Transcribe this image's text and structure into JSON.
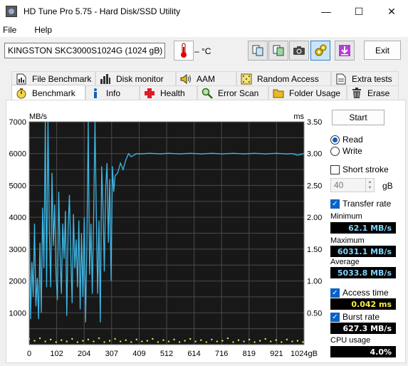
{
  "window": {
    "title": "HD Tune Pro 5.75 - Hard Disk/SSD Utility",
    "minimize": "—",
    "maximize": "☐",
    "close": "✕"
  },
  "menu": {
    "file": "File",
    "help": "Help"
  },
  "toolbar": {
    "drive": "KINGSTON SKC3000S1024G (1024 gB)",
    "temperature": "– °C",
    "exit": "Exit"
  },
  "tabs_row1": [
    "File Benchmark",
    "Disk monitor",
    "AAM",
    "Random Access",
    "Extra tests"
  ],
  "tabs_row2": [
    "Benchmark",
    "Info",
    "Health",
    "Error Scan",
    "Folder Usage",
    "Erase"
  ],
  "active_tab": "Benchmark",
  "controls": {
    "start": "Start",
    "read": "Read",
    "write": "Write",
    "mode": "Read",
    "short_stroke": "Short stroke",
    "short_stroke_checked": false,
    "short_stroke_value": "40",
    "short_stroke_unit": "gB",
    "transfer_rate": "Transfer rate",
    "transfer_rate_checked": true,
    "access_time": "Access time",
    "access_time_checked": true,
    "burst_rate": "Burst rate",
    "burst_rate_checked": true
  },
  "stats": {
    "minimum_label": "Minimum",
    "minimum": "62.1 MB/s",
    "maximum_label": "Maximum",
    "maximum": "6031.1 MB/s",
    "average_label": "Average",
    "average": "5033.8 MB/s",
    "access_time": "0.042 ms",
    "burst_rate": "627.3 MB/s",
    "cpu_label": "CPU usage",
    "cpu": "4.0%"
  },
  "chart_data": {
    "type": "line",
    "left_axis_label": "MB/s",
    "right_axis_label": "ms",
    "y_ticks": [
      "7000",
      "6000",
      "5000",
      "4000",
      "3000",
      "2000",
      "1000"
    ],
    "y2_ticks": [
      "3.50",
      "3.00",
      "2.50",
      "2.00",
      "1.50",
      "1.00",
      "0.50"
    ],
    "x_ticks": [
      "0",
      "102",
      "204",
      "307",
      "409",
      "512",
      "614",
      "716",
      "819",
      "921",
      "1024gB"
    ],
    "ylim": [
      0,
      7000
    ],
    "y2lim": [
      0,
      3.5
    ],
    "xlim": [
      0,
      1024
    ],
    "colors": {
      "transfer": "#3fb8e6",
      "access": "#e8e84a",
      "background": "#181818",
      "grid": "#4a4a4a"
    },
    "series": [
      {
        "name": "Transfer rate",
        "x": [
          0,
          5,
          10,
          15,
          20,
          25,
          30,
          35,
          40,
          45,
          50,
          55,
          60,
          62,
          65,
          68,
          70,
          75,
          80,
          85,
          90,
          95,
          100,
          105,
          110,
          115,
          120,
          125,
          130,
          135,
          140,
          145,
          150,
          155,
          160,
          165,
          170,
          175,
          180,
          185,
          190,
          195,
          200,
          205,
          210,
          215,
          220,
          225,
          230,
          235,
          240,
          245,
          250,
          255,
          260,
          265,
          270,
          275,
          280,
          285,
          290,
          295,
          300,
          305,
          310,
          315,
          320,
          330,
          340,
          350,
          360,
          370,
          380,
          390,
          400,
          410,
          430,
          450,
          470,
          490,
          500,
          520,
          540,
          560,
          580,
          600,
          620,
          640,
          660,
          680,
          700,
          720,
          740,
          760,
          780,
          800,
          820,
          840,
          860,
          880,
          900,
          920,
          940,
          960,
          980,
          1000,
          1024
        ],
        "values": [
          3900,
          800,
          2600,
          1500,
          3800,
          1200,
          2100,
          800,
          3200,
          1000,
          4300,
          2400,
          7000,
          4500,
          1800,
          5200,
          7000,
          3600,
          1800,
          5400,
          3100,
          4400,
          2200,
          1400,
          4800,
          2900,
          1600,
          3800,
          2700,
          4200,
          900,
          3700,
          4700,
          2800,
          1300,
          4100,
          2400,
          3300,
          1800,
          3900,
          1100,
          3500,
          1500,
          4000,
          700,
          3100,
          7000,
          2200,
          3800,
          1600,
          4000,
          7000,
          4200,
          1600,
          3900,
          700,
          5600,
          4300,
          2300,
          4900,
          5700,
          3200,
          5200,
          2000,
          5600,
          4800,
          5300,
          5400,
          5700,
          5500,
          5800,
          6000,
          5900,
          5950,
          6000,
          5990,
          6000,
          6010,
          6000,
          5990,
          6000,
          6010,
          6000,
          5990,
          6000,
          6010,
          6000,
          5990,
          6000,
          6010,
          6000,
          5990,
          6000,
          6010,
          6000,
          5990,
          6000,
          6010,
          6000,
          5990,
          6000,
          6010,
          6000,
          5990,
          6000,
          5950,
          6000
        ]
      },
      {
        "name": "Access time",
        "y_axis": "right",
        "x": [
          0,
          20,
          40,
          60,
          80,
          100,
          120,
          140,
          160,
          180,
          200,
          220,
          240,
          260,
          280,
          300,
          320,
          340,
          360,
          380,
          400,
          420,
          440,
          460,
          480,
          500,
          520,
          540,
          560,
          580,
          600,
          620,
          640,
          660,
          680,
          700,
          720,
          740,
          760,
          780,
          800,
          820,
          840,
          860,
          880,
          900,
          920,
          940,
          960,
          980,
          1000,
          1020
        ],
        "values": [
          0.09,
          0.06,
          0.1,
          0.05,
          0.08,
          0.04,
          0.07,
          0.05,
          0.09,
          0.04,
          0.06,
          0.08,
          0.05,
          0.1,
          0.04,
          0.06,
          0.09,
          0.05,
          0.07,
          0.04,
          0.08,
          0.05,
          0.06,
          0.09,
          0.04,
          0.07,
          0.05,
          0.08,
          0.04,
          0.06,
          0.09,
          0.05,
          0.07,
          0.04,
          0.08,
          0.05,
          0.06,
          0.1,
          0.04,
          0.07,
          0.05,
          0.08,
          0.04,
          0.06,
          0.09,
          0.05,
          0.07,
          0.04,
          0.08,
          0.05,
          0.06,
          0.04
        ]
      }
    ],
    "grid": true
  }
}
